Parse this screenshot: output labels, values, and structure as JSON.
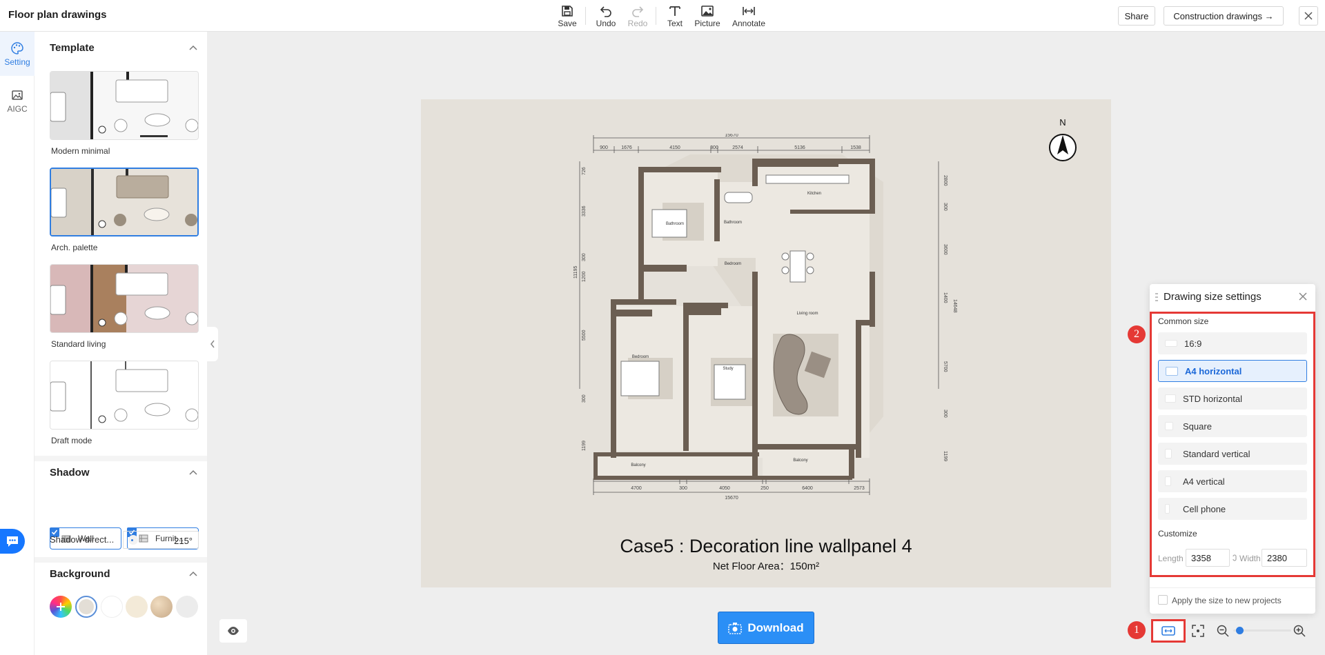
{
  "app": {
    "title": "Floor plan drawings"
  },
  "toolbar": {
    "save": "Save",
    "undo": "Undo",
    "redo": "Redo",
    "text": "Text",
    "picture": "Picture",
    "annotate": "Annotate",
    "share": "Share",
    "construction": "Construction drawings →"
  },
  "rail": {
    "setting": "Setting",
    "aigc": "AIGC"
  },
  "template": {
    "heading": "Template",
    "items": [
      {
        "label": "Modern minimal",
        "selected": false
      },
      {
        "label": "Arch. palette",
        "selected": true
      },
      {
        "label": "Standard living",
        "selected": false
      },
      {
        "label": "Draft mode",
        "selected": false
      }
    ]
  },
  "shadow": {
    "heading": "Shadow",
    "wall": "Wall",
    "furniture": "Furnit...",
    "direction_label": "Shadow direct...",
    "direction_value": "215°"
  },
  "background": {
    "heading": "Background",
    "swatches": [
      "#f1ece3",
      "#e3ded6",
      "#ffffff",
      "#f3ead8",
      "#d8c3a5",
      "#ececec"
    ]
  },
  "canvas": {
    "title": "Case5 : Decoration line wallpanel 4",
    "area": "Net Floor Area：150m²",
    "north": "N",
    "dims": {
      "top_total": "15670",
      "top": [
        "900",
        "1676",
        "4150",
        "300",
        "2574",
        "5136",
        "1538"
      ],
      "bottom_total": "15670",
      "bottom": [
        "4700",
        "300",
        "4050",
        "250",
        "6400",
        "2573"
      ],
      "left_total": "11195",
      "left": [
        "726",
        "3336",
        "300",
        "1200",
        "5500",
        "300",
        "1199"
      ],
      "right": [
        "2800",
        "300",
        "3600",
        "1400",
        "5700",
        "300",
        "1199"
      ],
      "right_total": "14648"
    },
    "rooms": [
      "Kitchen",
      "Bathroom",
      "Bathroom",
      "Bedroom",
      "Living room",
      "Bedroom",
      "Study",
      "Balcony",
      "Balcony"
    ]
  },
  "download": "Download",
  "dialog": {
    "title": "Drawing size settings",
    "common_size": "Common size",
    "options": [
      {
        "label": "16:9",
        "selected": false
      },
      {
        "label": "A4 horizontal",
        "selected": true
      },
      {
        "label": "STD horizontal",
        "selected": false
      },
      {
        "label": "Square",
        "selected": false
      },
      {
        "label": "Standard vertical",
        "selected": false
      },
      {
        "label": "A4 vertical",
        "selected": false
      },
      {
        "label": "Cell phone",
        "selected": false
      }
    ],
    "customize": "Customize",
    "length_label": "Length",
    "length_value": "3358",
    "width_label": "Width",
    "width_value": "2380",
    "apply": "Apply the size to new projects"
  },
  "badges": {
    "one": "1",
    "two": "2"
  },
  "zoom": {
    "level": 0.05
  }
}
